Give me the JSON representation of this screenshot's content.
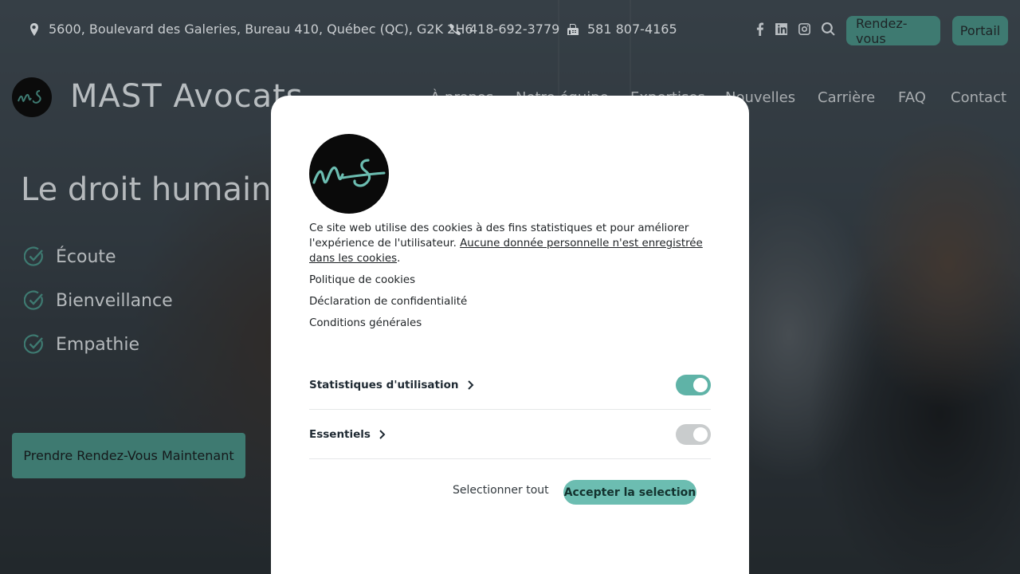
{
  "topbar": {
    "address": "5600, Boulevard des Galeries, Bureau 410, Québec (QC), G2K 2H6",
    "phone": "418-692-3779",
    "fax": "581 807-4165",
    "rendezvous_label": "Rendez-vous",
    "portail_label": "Portail"
  },
  "header": {
    "brand": "MAST Avocats",
    "nav": [
      "À propos",
      "Notre équipe",
      "Expertises",
      "Nouvelles",
      "Carrière",
      "FAQ",
      "Contact"
    ]
  },
  "hero": {
    "title": "Le droit humain",
    "features": [
      "Écoute",
      "Bienveillance",
      "Empathie"
    ],
    "cta_label": "Prendre Rendez-Vous Maintenant"
  },
  "cookie_modal": {
    "text_intro": "Ce site web utilise des cookies à des fins statistiques et pour améliorer l'expérience de l'utilisateur. ",
    "text_link": "Aucune donnée personnelle n'est enregistrée dans les cookies",
    "text_end": ".",
    "links": [
      "Politique de cookies",
      "Déclaration de confidentialité",
      "Conditions générales"
    ],
    "preferences": [
      {
        "label": "Statistiques d'utilisation",
        "enabled": true,
        "color": "#5fb3a7"
      },
      {
        "label": "Essentiels",
        "enabled": true,
        "color": "#c9cccd"
      }
    ],
    "select_all_label": "Selectionner tout",
    "accept_label": "Accepter la selection"
  },
  "colors": {
    "accent": "#5fb3a7",
    "accent_dim": "#3e7a71"
  }
}
